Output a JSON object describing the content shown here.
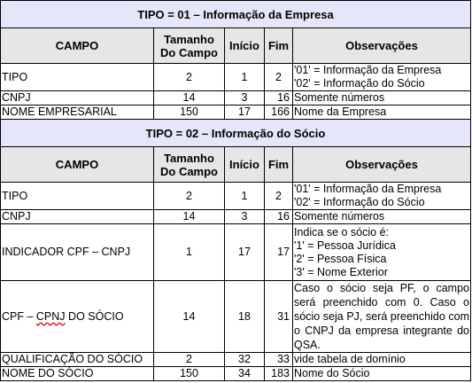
{
  "columns": [
    "CAMPO",
    "Tamanho Do Campo",
    "Início",
    "Fim",
    "Observações"
  ],
  "columns_tamanho_line1": "Tamanho",
  "columns_tamanho_line2": "Do Campo",
  "sections": [
    {
      "title": "TIPO = 01 – Informação da Empresa",
      "rows": [
        {
          "campo": "TIPO",
          "tamanho": "2",
          "inicio": "1",
          "fim": "2",
          "obs": [
            "'01' = Informação da Empresa",
            "'02' = Informação do Sócio"
          ]
        },
        {
          "campo": "CNPJ",
          "tamanho": "14",
          "inicio": "3",
          "fim": "16",
          "obs": [
            "Somente números"
          ]
        },
        {
          "campo": "NOME EMPRESARIAL",
          "tamanho": "150",
          "inicio": "17",
          "fim": "166",
          "obs": [
            "Nome da Empresa"
          ]
        }
      ]
    },
    {
      "title": "TIPO = 02 – Informação do Sócio",
      "rows": [
        {
          "campo": "TIPO",
          "tamanho": "2",
          "inicio": "1",
          "fim": "2",
          "obs": [
            "'01' = Informação da Empresa",
            "'02' = Informação do Sócio"
          ]
        },
        {
          "campo": "CNPJ",
          "tamanho": "14",
          "inicio": "3",
          "fim": "16",
          "obs": [
            "Somente números"
          ]
        },
        {
          "campo": "INDICADOR CPF – CNPJ",
          "tamanho": "1",
          "inicio": "17",
          "fim": "17",
          "obs": [
            "Indica se o sócio é:",
            "'1' = Pessoa Jurídica",
            "'2' = Pessoa Física",
            "'3' = Nome Exterior"
          ]
        },
        {
          "campo_a": "CPF – ",
          "campo_b": "CPNJ",
          "campo_c": " DO SÓCIO",
          "tamanho": "14",
          "inicio": "18",
          "fim": "31",
          "obs_text": "Caso o sócio seja PF, o campo será preenchido com 0. Caso o sócio seja PJ, será preenchido com o CNPJ da empresa integrante do QSA."
        },
        {
          "campo": "QUALIFICAÇÃO DO SÓCIO",
          "tamanho": "2",
          "inicio": "32",
          "fim": "33",
          "obs": [
            "vide tabela de domínio"
          ]
        },
        {
          "campo": "NOME DO SÓCIO",
          "tamanho": "150",
          "inicio": "34",
          "fim": "183",
          "obs": [
            "Nome do Sócio"
          ]
        }
      ]
    }
  ]
}
